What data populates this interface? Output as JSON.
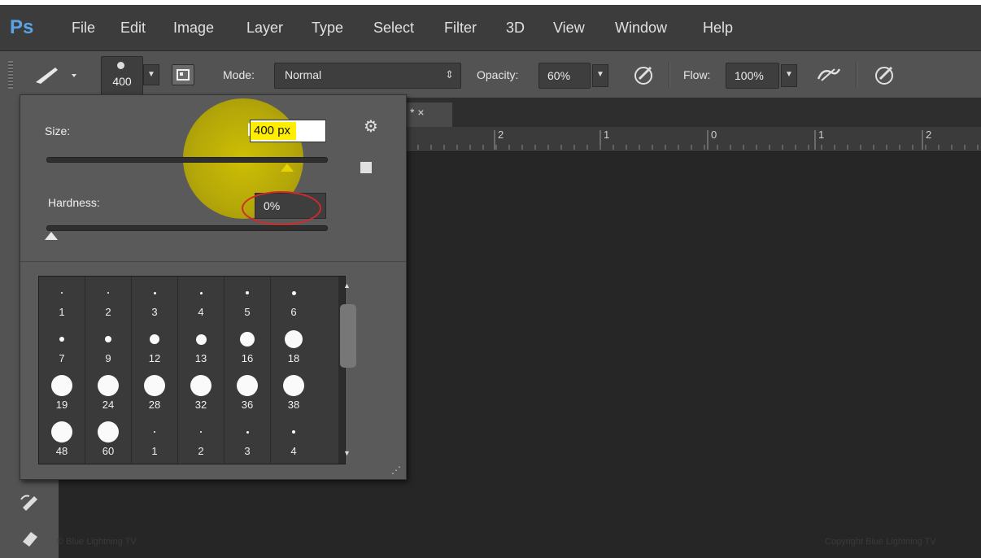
{
  "app": {
    "logo": "Ps"
  },
  "menu": [
    "File",
    "Edit",
    "Image",
    "Layer",
    "Type",
    "Select",
    "Filter",
    "3D",
    "View",
    "Window",
    "Help"
  ],
  "options": {
    "brush_size": "400",
    "mode_label": "Mode:",
    "mode_value": "Normal",
    "opacity_label": "Opacity:",
    "opacity_value": "60%",
    "flow_label": "Flow:",
    "flow_value": "100%"
  },
  "tab": {
    "marker": "* ×"
  },
  "ruler": [
    "2",
    "1",
    "0",
    "1",
    "2"
  ],
  "brush_panel": {
    "size_label": "Size:",
    "size_value": "400",
    "size_unit": "px",
    "size_slider_fraction": 0.86,
    "hardness_label": "Hardness:",
    "hardness_value": "0%",
    "hardness_slider_fraction": 0.0,
    "presets": [
      {
        "n": "1",
        "d": 2
      },
      {
        "n": "2",
        "d": 2
      },
      {
        "n": "3",
        "d": 3
      },
      {
        "n": "4",
        "d": 3
      },
      {
        "n": "5",
        "d": 4
      },
      {
        "n": "6",
        "d": 5
      },
      {
        "n": "7",
        "d": 6
      },
      {
        "n": "9",
        "d": 8
      },
      {
        "n": "12",
        "d": 12
      },
      {
        "n": "13",
        "d": 13
      },
      {
        "n": "16",
        "d": 18
      },
      {
        "n": "18",
        "d": 22
      },
      {
        "n": "19",
        "d": 26
      },
      {
        "n": "24",
        "d": 26
      },
      {
        "n": "28",
        "d": 26
      },
      {
        "n": "32",
        "d": 26
      },
      {
        "n": "36",
        "d": 26
      },
      {
        "n": "38",
        "d": 26
      },
      {
        "n": "48",
        "d": 26
      },
      {
        "n": "60",
        "d": 26
      },
      {
        "n": "1",
        "d": 2
      },
      {
        "n": "2",
        "d": 2
      },
      {
        "n": "3",
        "d": 3
      },
      {
        "n": "4",
        "d": 4
      }
    ]
  },
  "watermarks": {
    "left": "© Blue Lightning TV",
    "right": "Copyright Blue Lightning TV"
  },
  "colors": {
    "logo": "#5aa3e8",
    "highlight": "#ffee00",
    "ring": "#d02a2a"
  }
}
